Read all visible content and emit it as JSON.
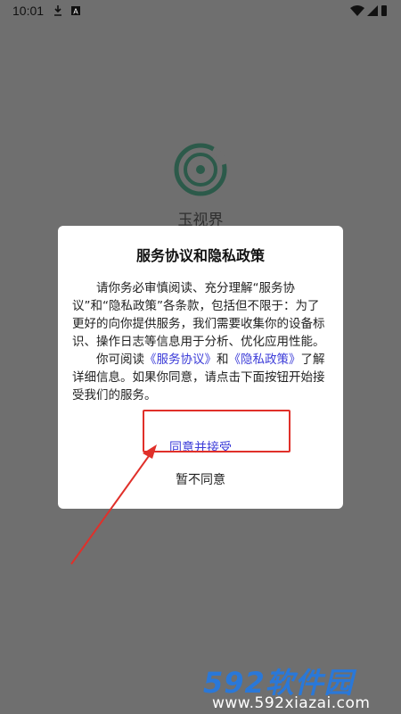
{
  "status_bar": {
    "time": "10:01"
  },
  "app": {
    "name": "玉视界"
  },
  "dialog": {
    "title": "服务协议和隐私政策",
    "paragraph1": "请你务必审慎阅读、充分理解“服务协议”和“隐私政策”各条款，包括但不限于：为了更好的向你提供服务，我们需要收集你的设备标识、操作日志等信息用于分析、优化应用性能。",
    "p2_prefix": "你可阅读",
    "p2_link1": "《服务协议》",
    "p2_and": "和",
    "p2_link2": "《隐私政策》",
    "p2_suffix": "了解详细信息。如果你同意，请点击下面按钮开始接受我们的服务。",
    "accept_label": "同意并接受",
    "decline_label": "暂不同意"
  },
  "watermark": {
    "brand_num": "592",
    "brand_text": "软件园",
    "url": "www.592xiazai.com"
  },
  "colors": {
    "overlay": "#6f6f6f",
    "link": "#3b3bd8",
    "highlight": "#e0302a",
    "brand": "#2a78d8"
  }
}
